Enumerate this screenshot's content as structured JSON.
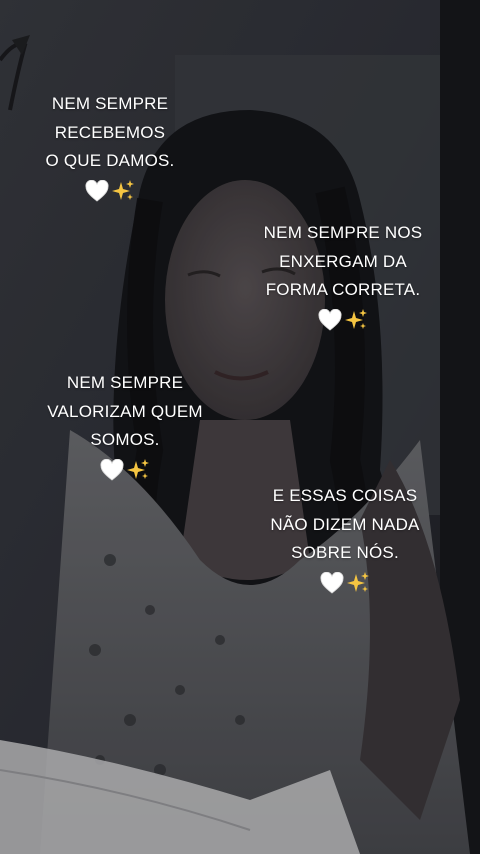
{
  "captions": [
    {
      "lines": [
        "NEM SEMPRE",
        "RECEBEMOS",
        "O QUE DAMOS."
      ],
      "emoji": "🤍✨"
    },
    {
      "lines": [
        "NEM SEMPRE NOS",
        "ENXERGAM DA",
        "FORMA CORRETA."
      ],
      "emoji": "🤍✨"
    },
    {
      "lines": [
        "NEM SEMPRE",
        "VALORIZAM QUEM",
        "SOMOS."
      ],
      "emoji": "🤍✨"
    },
    {
      "lines": [
        "E ESSAS COISAS",
        "NÃO DIZEM NADA",
        "SOBRE NÓS."
      ],
      "emoji": "🤍✨"
    }
  ],
  "icons": [
    "white-heart-icon",
    "sparkles-icon"
  ],
  "colors": {
    "text": "#ffffff",
    "background": "#2b2d33",
    "sparkle": "#f5c542"
  }
}
